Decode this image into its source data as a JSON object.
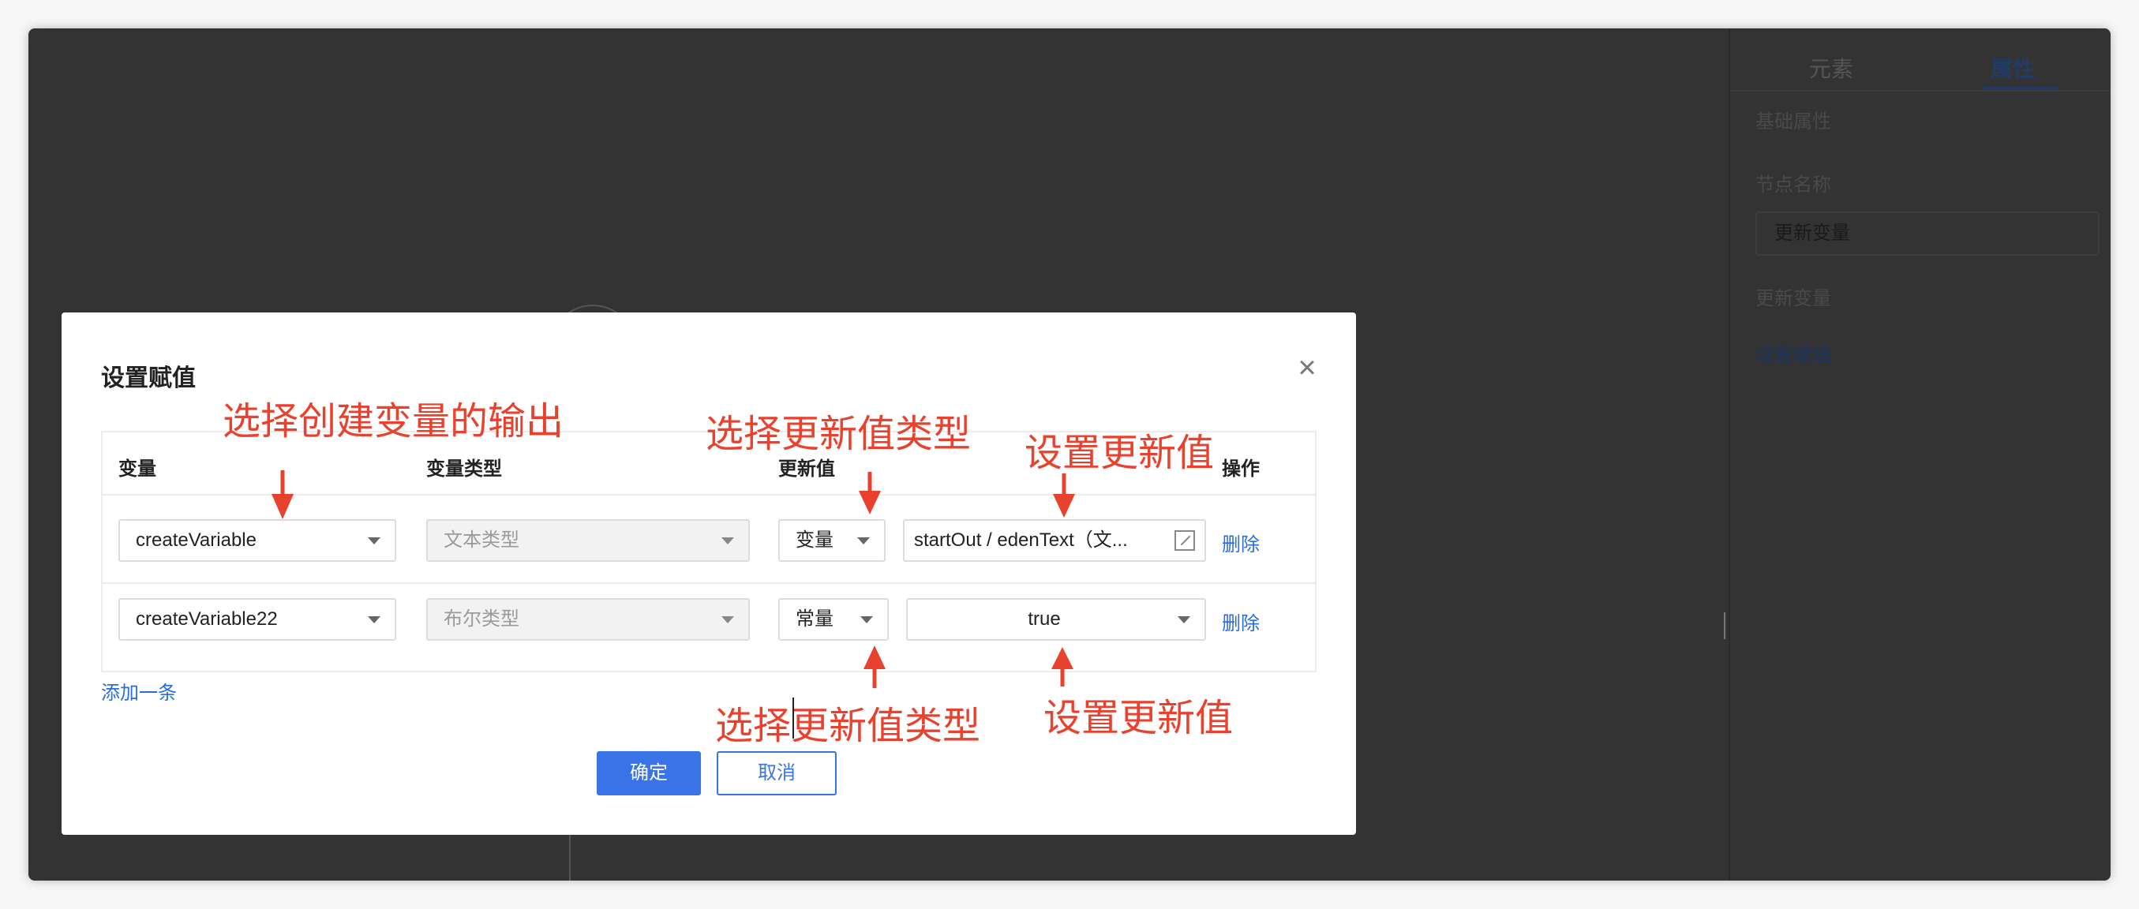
{
  "right_panel": {
    "tabs": [
      "元素",
      "属性"
    ],
    "section_title": "基础属性",
    "node_name_label": "节点名称",
    "node_name_value": "更新变量",
    "update_var_label": "更新变量",
    "set_value_link": "设置赋值"
  },
  "modal": {
    "title": "设置赋值",
    "columns": [
      "变量",
      "变量类型",
      "更新值",
      "操作"
    ],
    "rows": [
      {
        "variable": "createVariable",
        "variable_type": "文本类型",
        "value_mode": "变量",
        "value": "startOut / edenText（文...",
        "action": "删除"
      },
      {
        "variable": "createVariable22",
        "variable_type": "布尔类型",
        "value_mode": "常量",
        "value": "true",
        "action": "删除"
      }
    ],
    "add_row": "添加一条",
    "ok_label": "确定",
    "cancel_label": "取消"
  },
  "annotations": {
    "select_output": "选择创建变量的输出",
    "select_value_type_top": "选择更新值类型",
    "set_value_top": "设置更新值",
    "select_value_type_bottom": "选择更新值类型",
    "set_value_bottom": "设置更新值"
  },
  "colors": {
    "annotation": "#e8412e",
    "primary": "#3a73e8",
    "overlay": "#333333"
  }
}
